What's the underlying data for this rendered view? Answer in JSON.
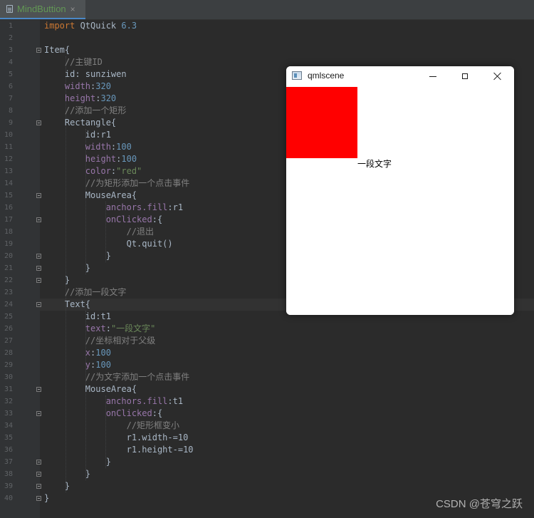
{
  "editor": {
    "tab": {
      "title": "MindButtion",
      "close_glyph": "×",
      "icon": "file-icon"
    },
    "line_numbers": [
      "1",
      "2",
      "3",
      "4",
      "5",
      "6",
      "7",
      "8",
      "9",
      "10",
      "11",
      "12",
      "13",
      "14",
      "15",
      "16",
      "17",
      "18",
      "19",
      "20",
      "21",
      "22",
      "23",
      "24",
      "25",
      "26",
      "27",
      "28",
      "29",
      "30",
      "31",
      "32",
      "33",
      "34",
      "35",
      "36",
      "37",
      "38",
      "39",
      "40"
    ],
    "code_lines": [
      [
        {
          "t": "import",
          "c": "kw"
        },
        {
          "t": " QtQuick ",
          "c": "ty"
        },
        {
          "t": "6.3",
          "c": "num"
        }
      ],
      [],
      [
        {
          "t": "Item{",
          "c": "ty"
        }
      ],
      [
        {
          "t": "    //主键ID",
          "c": "com"
        }
      ],
      [
        {
          "t": "    id: sunziwen",
          "c": "ty"
        }
      ],
      [
        {
          "t": "    width",
          "c": "prop"
        },
        {
          "t": ":",
          "c": "ty"
        },
        {
          "t": "320",
          "c": "num"
        }
      ],
      [
        {
          "t": "    height",
          "c": "prop"
        },
        {
          "t": ":",
          "c": "ty"
        },
        {
          "t": "320",
          "c": "num"
        }
      ],
      [
        {
          "t": "    //添加一个矩形",
          "c": "com"
        }
      ],
      [
        {
          "t": "    Rectangle{",
          "c": "ty"
        }
      ],
      [
        {
          "t": "        id:r1",
          "c": "ty"
        }
      ],
      [
        {
          "t": "        width",
          "c": "prop"
        },
        {
          "t": ":",
          "c": "ty"
        },
        {
          "t": "100",
          "c": "num"
        }
      ],
      [
        {
          "t": "        height",
          "c": "prop"
        },
        {
          "t": ":",
          "c": "ty"
        },
        {
          "t": "100",
          "c": "num"
        }
      ],
      [
        {
          "t": "        color",
          "c": "prop"
        },
        {
          "t": ":",
          "c": "ty"
        },
        {
          "t": "\"red\"",
          "c": "str"
        }
      ],
      [
        {
          "t": "        //为矩形添加一个点击事件",
          "c": "com"
        }
      ],
      [
        {
          "t": "        MouseArea{",
          "c": "ty"
        }
      ],
      [
        {
          "t": "            anchors.fill",
          "c": "prop"
        },
        {
          "t": ":r1",
          "c": "ty"
        }
      ],
      [
        {
          "t": "            onClicked",
          "c": "prop"
        },
        {
          "t": ":{",
          "c": "ty"
        }
      ],
      [
        {
          "t": "                //退出",
          "c": "com"
        }
      ],
      [
        {
          "t": "                Qt.quit()",
          "c": "ty"
        }
      ],
      [
        {
          "t": "            }",
          "c": "ty"
        }
      ],
      [
        {
          "t": "        }",
          "c": "ty"
        }
      ],
      [
        {
          "t": "    }",
          "c": "ty"
        }
      ],
      [
        {
          "t": "    //添加一段文字",
          "c": "com"
        }
      ],
      [
        {
          "t": "    Text{",
          "c": "ty"
        }
      ],
      [
        {
          "t": "        id:t1",
          "c": "ty"
        }
      ],
      [
        {
          "t": "        text",
          "c": "prop"
        },
        {
          "t": ":",
          "c": "ty"
        },
        {
          "t": "\"一段文字\"",
          "c": "str"
        }
      ],
      [
        {
          "t": "        //坐标相对于父级",
          "c": "com"
        }
      ],
      [
        {
          "t": "        x",
          "c": "prop"
        },
        {
          "t": ":",
          "c": "ty"
        },
        {
          "t": "100",
          "c": "num"
        }
      ],
      [
        {
          "t": "        y",
          "c": "prop"
        },
        {
          "t": ":",
          "c": "ty"
        },
        {
          "t": "100",
          "c": "num"
        }
      ],
      [
        {
          "t": "        //为文字添加一个点击事件",
          "c": "com"
        }
      ],
      [
        {
          "t": "        MouseArea{",
          "c": "ty"
        }
      ],
      [
        {
          "t": "            anchors.fill",
          "c": "prop"
        },
        {
          "t": ":t1",
          "c": "ty"
        }
      ],
      [
        {
          "t": "            onClicked",
          "c": "prop"
        },
        {
          "t": ":{",
          "c": "ty"
        }
      ],
      [
        {
          "t": "                //矩形框变小",
          "c": "com"
        }
      ],
      [
        {
          "t": "                r1.width-=10",
          "c": "ty"
        }
      ],
      [
        {
          "t": "                r1.height-=10",
          "c": "ty"
        }
      ],
      [
        {
          "t": "            }",
          "c": "ty"
        }
      ],
      [
        {
          "t": "        }",
          "c": "ty"
        }
      ],
      [
        {
          "t": "    }",
          "c": "ty"
        }
      ],
      [
        {
          "t": "}",
          "c": "ty"
        }
      ]
    ]
  },
  "qml_window": {
    "title": "qmlscene",
    "app_icon": "qml-app-icon",
    "buttons": {
      "minimize": "minimize-icon",
      "maximize": "maximize-icon",
      "close": "close-icon"
    },
    "rectangle": {
      "color": "#ff0000"
    },
    "text_item": {
      "text": "一段文字"
    }
  },
  "watermark": "CSDN @苍穹之跃"
}
